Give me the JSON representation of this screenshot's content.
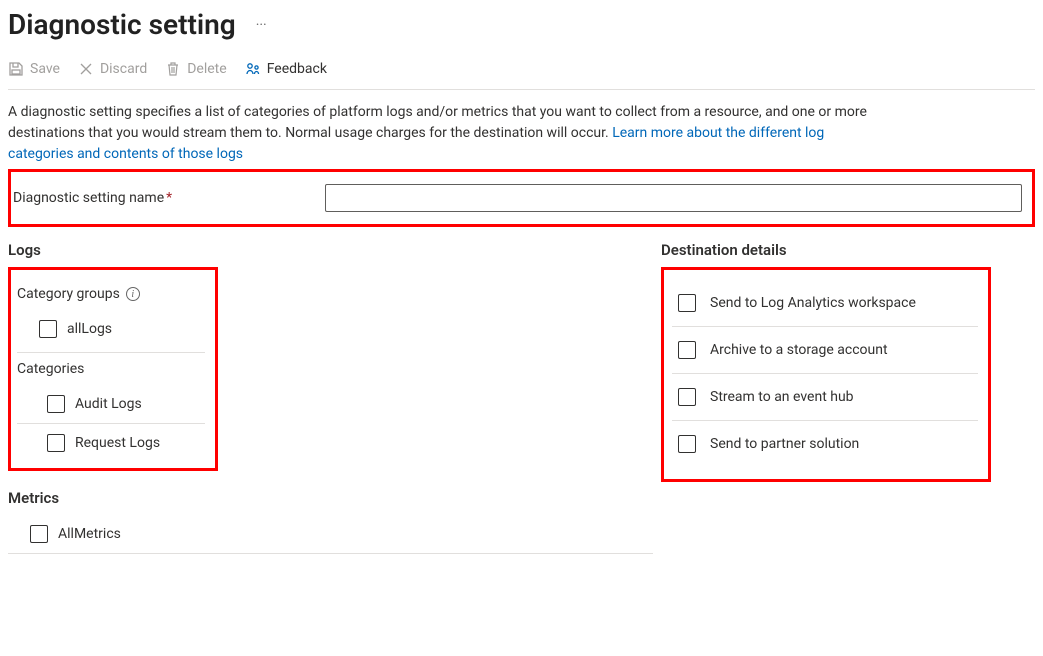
{
  "header": {
    "title": "Diagnostic setting"
  },
  "toolbar": {
    "save_label": "Save",
    "discard_label": "Discard",
    "delete_label": "Delete",
    "feedback_label": "Feedback"
  },
  "description": {
    "text": "A diagnostic setting specifies a list of categories of platform logs and/or metrics that you want to collect from a resource, and one or more destinations that you would stream them to. Normal usage charges for the destination will occur. ",
    "link_text": "Learn more about the different log categories and contents of those logs"
  },
  "name_field": {
    "label": "Diagnostic setting name",
    "value": ""
  },
  "logs": {
    "section_title": "Logs",
    "category_groups_label": "Category groups",
    "all_logs_label": "allLogs",
    "categories_label": "Categories",
    "items": [
      {
        "label": "Audit Logs"
      },
      {
        "label": "Request Logs"
      }
    ]
  },
  "metrics": {
    "section_title": "Metrics",
    "all_metrics_label": "AllMetrics"
  },
  "destinations": {
    "section_title": "Destination details",
    "items": [
      {
        "label": "Send to Log Analytics workspace"
      },
      {
        "label": "Archive to a storage account"
      },
      {
        "label": "Stream to an event hub"
      },
      {
        "label": "Send to partner solution"
      }
    ]
  }
}
